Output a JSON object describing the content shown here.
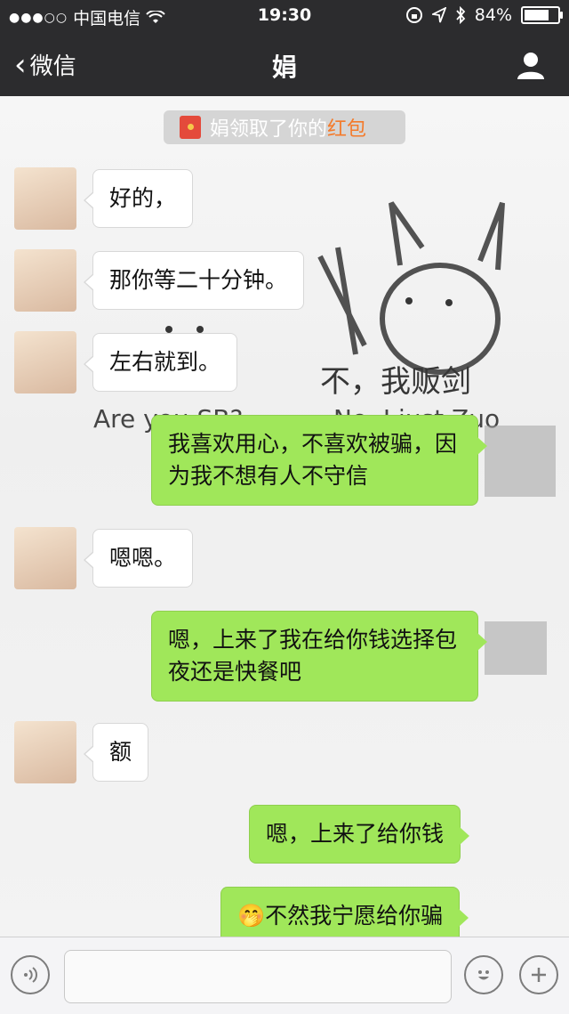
{
  "status_bar": {
    "carrier": "中国电信",
    "time": "19:30",
    "battery_percent_text": "84%",
    "battery_level": 0.84
  },
  "nav": {
    "back_label": "微信",
    "title": "娟"
  },
  "system_message": {
    "prefix": "娟领取了你的",
    "link": "红包"
  },
  "background_text": {
    "top_left": "Are you SB?",
    "top_right": "不，我贩剑",
    "bottom_right": "No, I just Zuo"
  },
  "messages": [
    {
      "side": "in",
      "text": "好的，"
    },
    {
      "side": "in",
      "text": "那你等二十分钟。"
    },
    {
      "side": "in",
      "text": "左右就到。"
    },
    {
      "side": "out",
      "text": "我喜欢用心，不喜欢被骗，因为我不想有人不守信"
    },
    {
      "side": "in",
      "text": "嗯嗯。"
    },
    {
      "side": "out",
      "text": "嗯，上来了我在给你钱选择包夜还是快餐吧"
    },
    {
      "side": "in",
      "text": "额"
    },
    {
      "side": "out",
      "text": "嗯，上来了给你钱"
    },
    {
      "side": "out",
      "text": "🤭不然我宁愿给你骗"
    }
  ],
  "colors": {
    "accent_green": "#a0e75a",
    "nav_bg": "#2c2c2e",
    "red_packet": "#f47a2a"
  }
}
